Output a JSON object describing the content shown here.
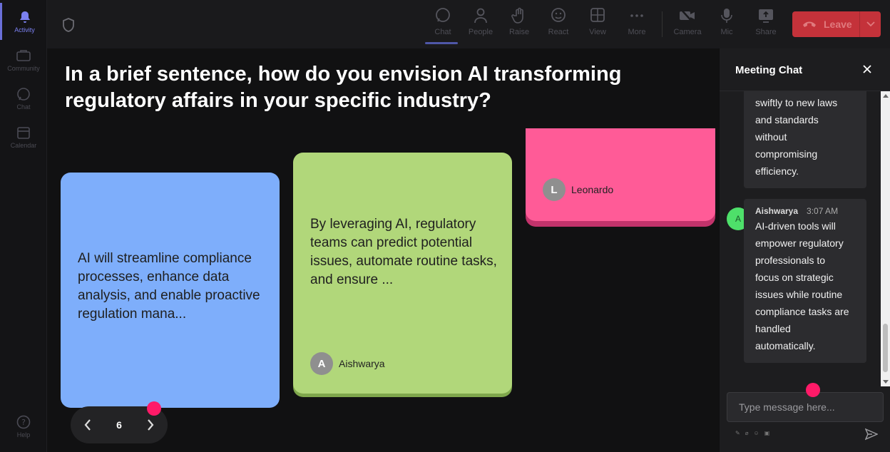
{
  "rail": {
    "items": [
      {
        "label": "Activity",
        "icon": "bell-icon",
        "active": true
      },
      {
        "label": "Community",
        "icon": "community-icon",
        "active": false
      },
      {
        "label": "Chat",
        "icon": "chat-icon",
        "active": false
      },
      {
        "label": "Calendar",
        "icon": "calendar-icon",
        "active": false
      }
    ],
    "help": {
      "label": "Help",
      "icon": "help-icon"
    }
  },
  "toolbar": {
    "chat": "Chat",
    "people": "People",
    "raise": "Raise",
    "react": "React",
    "view": "View",
    "more": "More",
    "camera": "Camera",
    "mic": "Mic",
    "share": "Share",
    "leave": "Leave"
  },
  "question": "In a brief sentence, how do you envision AI transforming regulatory affairs in your specific industry?",
  "cards": [
    {
      "text": "AI will streamline compliance processes, enhance data analysis, and enable proactive regulation mana...",
      "color": "#7eaefb"
    },
    {
      "text": "By leveraging AI, regulatory teams can predict potential issues, automate routine tasks, and ensure ...",
      "author": "Aishwarya",
      "initial": "A",
      "color": "#b1d77a"
    },
    {
      "author": "Leonardo",
      "initial": "L",
      "color": "#ff5b97"
    }
  ],
  "pager": {
    "page": "6"
  },
  "chat": {
    "title": "Meeting Chat",
    "messages": [
      {
        "text_lines": [
          "swiftly to new laws",
          "and standards",
          "without",
          "compromising",
          "efficiency."
        ]
      },
      {
        "sender": "Aishwarya",
        "initial": "A",
        "time": "3:07 AM",
        "text_lines": [
          "AI-driven tools will",
          "empower regulatory",
          "professionals to",
          "focus on strategic",
          "issues while routine",
          "compliance tasks are",
          "handled",
          "automatically."
        ]
      }
    ],
    "input_placeholder": "Type message here..."
  },
  "colors": {
    "accent": "#6a6fd8",
    "leave": "#c4323a",
    "cursor": "#ff1a68"
  }
}
